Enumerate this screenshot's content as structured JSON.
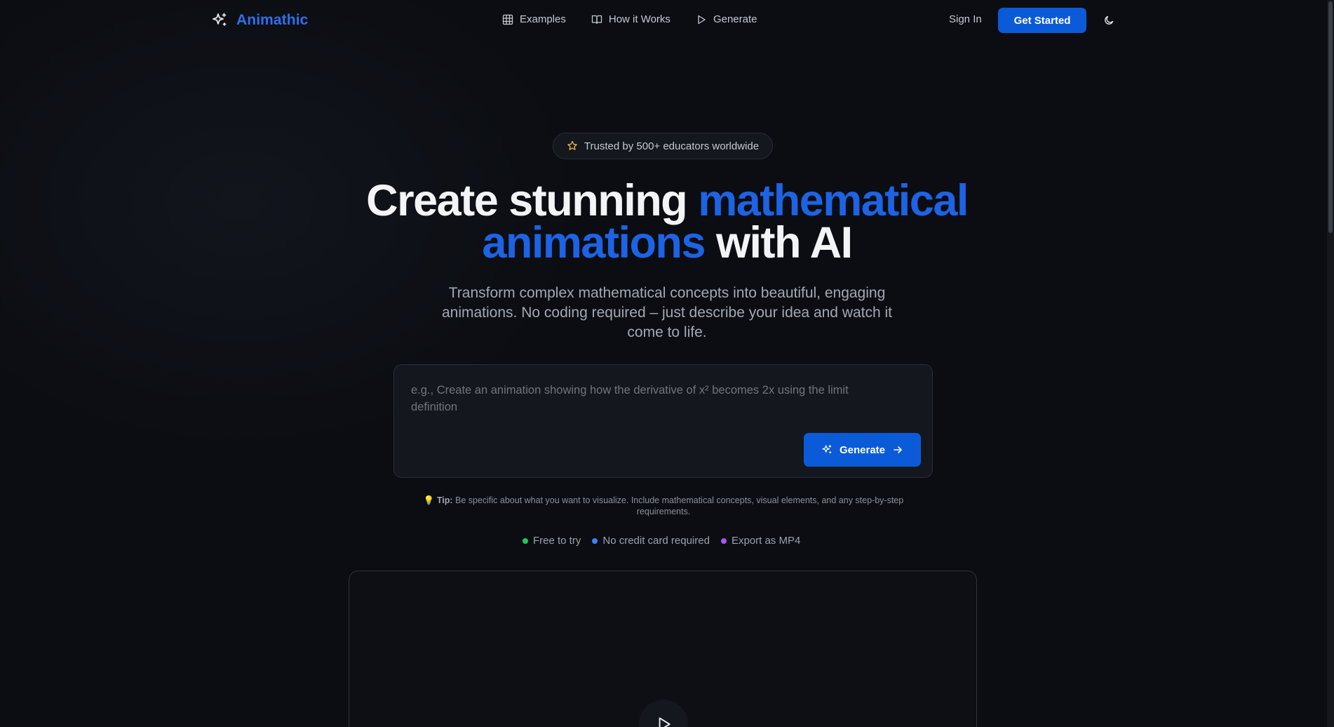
{
  "brand": {
    "name": "Animathic",
    "icon": "sparkles-icon",
    "color": "#2f6fed"
  },
  "nav": {
    "links": [
      {
        "label": "Examples",
        "icon": "table-icon"
      },
      {
        "label": "How it Works",
        "icon": "book-icon"
      },
      {
        "label": "Generate",
        "icon": "play-icon"
      }
    ],
    "sign_in": "Sign In",
    "get_started": "Get Started",
    "theme_toggle_icon": "moon-icon"
  },
  "hero": {
    "badge": "Trusted by 500+ educators worldwide",
    "badge_icon": "star-icon",
    "headline_part1": "Create stunning ",
    "headline_accent1": "mathematical",
    "headline_accent2": "animations",
    "headline_part2": " with AI",
    "subhead": "Transform complex mathematical concepts into beautiful, engaging animations. No coding required – just describe your idea and watch it come to life."
  },
  "prompt": {
    "placeholder": "e.g., Create an animation showing how the derivative of x² becomes 2x using the limit definition",
    "value": "",
    "button_label": "Generate"
  },
  "tip": {
    "emoji": "💡",
    "label": "Tip:",
    "text": " Be specific about what you want to visualize. Include mathematical concepts, visual elements, and any step-by-step requirements."
  },
  "features": [
    {
      "label": "Free to try",
      "color": "#22c55e"
    },
    {
      "label": "No credit card required",
      "color": "#3b82f6"
    },
    {
      "label": "Export as MP4",
      "color": "#a855f7"
    }
  ],
  "colors": {
    "accent": "#1d63e4",
    "button": "#0b5bd8",
    "background": "#0b0d12"
  }
}
